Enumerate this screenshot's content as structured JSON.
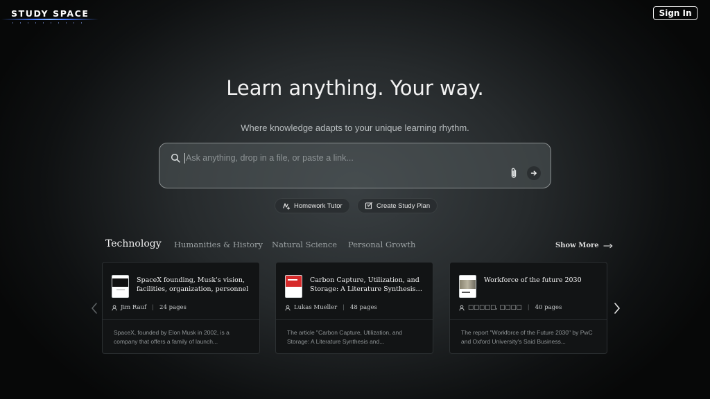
{
  "header": {
    "logo_text": "STUDY SPACE",
    "signin_label": "Sign In"
  },
  "hero": {
    "title": "Learn anything. Your way.",
    "subtitle": "Where knowledge adapts to your unique learning rhythm."
  },
  "search": {
    "placeholder": "Ask anything, drop in a file, or paste a link...",
    "value": "",
    "icons": [
      "search-icon",
      "paperclip-icon",
      "arrow-right-icon"
    ]
  },
  "chips": [
    {
      "label": "Homework Tutor",
      "icon": "homework-icon"
    },
    {
      "label": "Create Study Plan",
      "icon": "study-plan-icon"
    }
  ],
  "categories": {
    "tabs": [
      "Technology",
      "Humanities & History",
      "Natural Science",
      "Personal Growth"
    ],
    "active": "Technology",
    "show_more_label": "Show More"
  },
  "cards": [
    {
      "title": "SpaceX founding, Musk's vision, facilities, organization, personnel",
      "author": "Jim Rauf",
      "pages": "24 pages",
      "description": "SpaceX, founded by Elon Musk in 2002, is a company that offers a family of launch..."
    },
    {
      "title": "Carbon Capture, Utilization, and Storage: A Literature Synthesis a...",
      "author": "Lukas Mueller",
      "pages": "48 pages",
      "description": "The article \"Carbon Capture, Utilization, and Storage: A Literature Synthesis and..."
    },
    {
      "title": "Workforce of the future 2030",
      "author": "□□□□□, □□□□",
      "pages": "40 pages",
      "description": "The report \"Workforce of the Future 2030\" by PwC and Oxford University's Said Business..."
    }
  ],
  "colors": {
    "background": "#2f3436",
    "card_bg": "#121415",
    "accent_logo": "#4a7dff"
  }
}
